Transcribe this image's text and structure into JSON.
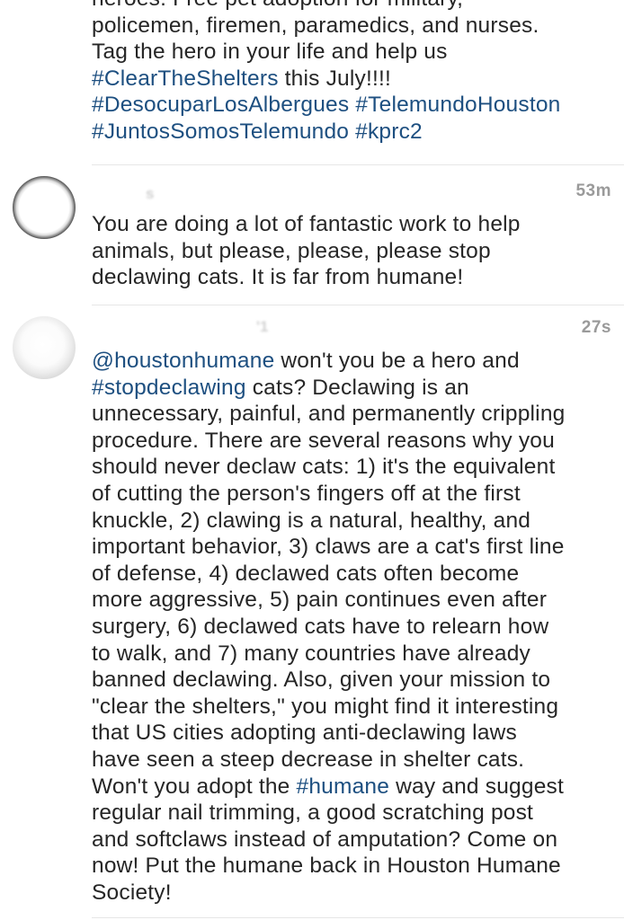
{
  "comments": [
    {
      "lines": [
        [
          {
            "t": "heroes:  Free pet adoption for military,",
            "link": false
          }
        ],
        [
          {
            "t": "policemen, firemen, paramedics, and nurses.",
            "link": false
          }
        ],
        [
          {
            "t": "Tag the hero in your life and help us",
            "link": false
          }
        ],
        [
          {
            "t": "#ClearTheShelters",
            "link": true
          },
          {
            "t": " this July!!!!",
            "link": false
          }
        ],
        [
          {
            "t": "#DesocuparLosAlbergues",
            "link": true
          },
          {
            "t": " ",
            "link": false
          },
          {
            "t": "#TelemundoHouston",
            "link": true
          }
        ],
        [
          {
            "t": "#JuntosSomosTelemundo",
            "link": true
          },
          {
            "t": " ",
            "link": false
          },
          {
            "t": "#kprc2",
            "link": true
          }
        ]
      ]
    },
    {
      "username": "s",
      "timestamp": "53m",
      "lines": [
        [
          {
            "t": "You are doing a lot of fantastic work to help",
            "link": false
          }
        ],
        [
          {
            "t": "animals, but please, please, please stop",
            "link": false
          }
        ],
        [
          {
            "t": "declawing cats. It is far from humane!",
            "link": false
          }
        ]
      ]
    },
    {
      "username": "'1",
      "timestamp": "27s",
      "lines": [
        [
          {
            "t": "@houstonhumane",
            "link": true
          },
          {
            "t": " won't you be a hero and",
            "link": false
          }
        ],
        [
          {
            "t": "#stopdeclawing",
            "link": true
          },
          {
            "t": " cats? Declawing is an",
            "link": false
          }
        ],
        [
          {
            "t": "unnecessary, painful, and permanently crippling",
            "link": false
          }
        ],
        [
          {
            "t": "procedure. There are several reasons why you",
            "link": false
          }
        ],
        [
          {
            "t": "should never declaw cats: 1) it's the equivalent",
            "link": false
          }
        ],
        [
          {
            "t": "of cutting the person's fingers off at the first",
            "link": false
          }
        ],
        [
          {
            "t": "knuckle, 2) clawing is a natural, healthy, and",
            "link": false
          }
        ],
        [
          {
            "t": "important behavior, 3) claws are a cat's first line",
            "link": false
          }
        ],
        [
          {
            "t": "of defense, 4) declawed cats often become",
            "link": false
          }
        ],
        [
          {
            "t": "more aggressive, 5) pain continues even after",
            "link": false
          }
        ],
        [
          {
            "t": "surgery, 6) declawed cats have to relearn how",
            "link": false
          }
        ],
        [
          {
            "t": "to walk, and 7) many countries have already",
            "link": false
          }
        ],
        [
          {
            "t": "banned declawing. Also, given your mission to",
            "link": false
          }
        ],
        [
          {
            "t": "\"clear the shelters,\" you might find it interesting",
            "link": false
          }
        ],
        [
          {
            "t": "that US cities adopting anti-declawing laws",
            "link": false
          }
        ],
        [
          {
            "t": "have seen a steep decrease in shelter cats.",
            "link": false
          }
        ],
        [
          {
            "t": "Won't you adopt the ",
            "link": false
          },
          {
            "t": "#humane",
            "link": true
          },
          {
            "t": " way and suggest",
            "link": false
          }
        ],
        [
          {
            "t": "regular nail trimming, a good scratching post",
            "link": false
          }
        ],
        [
          {
            "t": "and softclaws instead of amputation? Come on",
            "link": false
          }
        ],
        [
          {
            "t": "now! Put the humane back in Houston Humane",
            "link": false
          }
        ],
        [
          {
            "t": "Society!",
            "link": false
          }
        ]
      ]
    }
  ],
  "colors": {
    "text": "#262626",
    "link": "#1d4f80",
    "timestamp": "#9a9a9a",
    "divider": "#e6e6e6"
  }
}
